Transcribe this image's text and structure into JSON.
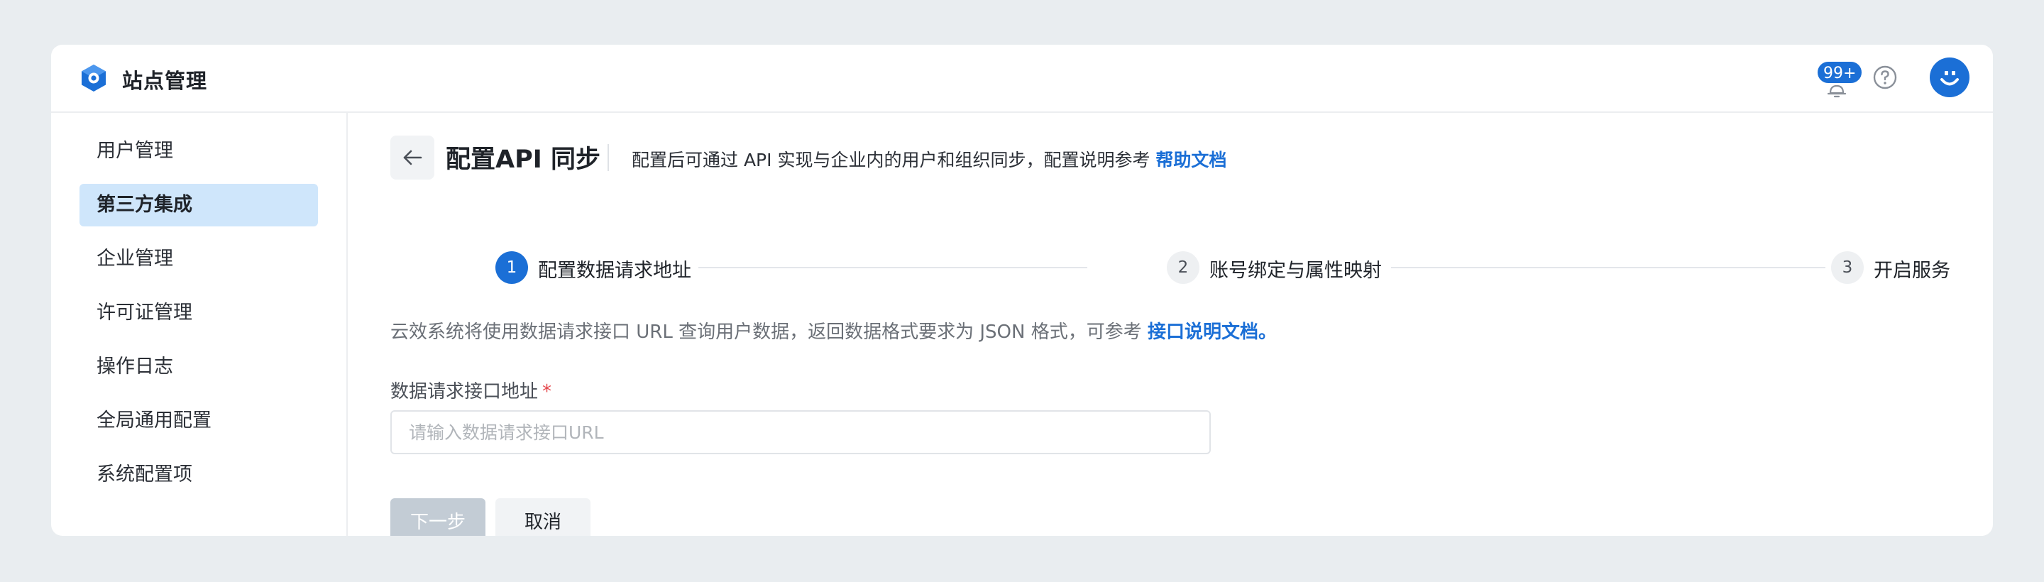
{
  "app": {
    "title": "站点管理"
  },
  "header": {
    "notification_count": "99+",
    "icons": {
      "logo": "cube-logo-icon",
      "bell": "bell-icon",
      "help": "help-circle-icon",
      "avatar": "avatar"
    }
  },
  "sidebar": {
    "items": [
      {
        "label": "用户管理",
        "active": false
      },
      {
        "label": "第三方集成",
        "active": true
      },
      {
        "label": "企业管理",
        "active": false
      },
      {
        "label": "许可证管理",
        "active": false
      },
      {
        "label": "操作日志",
        "active": false
      },
      {
        "label": "全局通用配置",
        "active": false
      },
      {
        "label": "系统配置项",
        "active": false
      }
    ]
  },
  "page": {
    "title": "配置API 同步",
    "description": "配置后可通过 API 实现与企业内的用户和组织同步，配置说明参考",
    "help_link": "帮助文档"
  },
  "steps": [
    {
      "number": "1",
      "label": "配置数据请求地址",
      "active": true
    },
    {
      "number": "2",
      "label": "账号绑定与属性映射",
      "active": false
    },
    {
      "number": "3",
      "label": "开启服务",
      "active": false
    }
  ],
  "form": {
    "intro": "云效系统将使用数据请求接口 URL 查询用户数据，返回数据格式要求为 JSON 格式，可参考",
    "intro_link": "接口说明文档。",
    "field_label": "数据请求接口地址",
    "required_mark": "*",
    "url_value": "",
    "url_placeholder": "请输入数据请求接口URL",
    "next_label": "下一步",
    "cancel_label": "取消"
  },
  "colors": {
    "primary": "#1b6fd6",
    "active_nav_bg": "#cfe6fb",
    "disabled_btn": "#c3ccd5",
    "required": "#e5484d"
  }
}
